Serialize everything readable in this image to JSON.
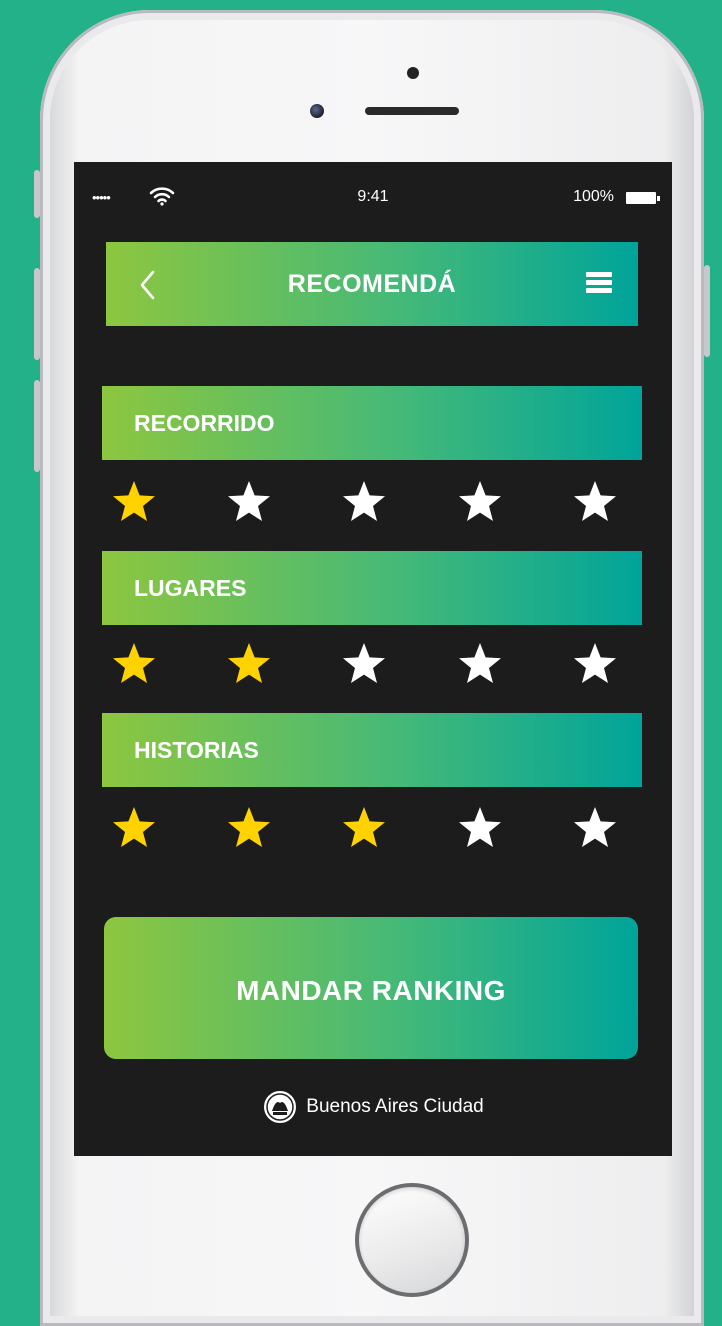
{
  "status_bar": {
    "signal": "•••••",
    "time": "9:41",
    "battery": "100%"
  },
  "header": {
    "title": "RECOMENDÁ",
    "back_icon": "chevron-left-icon",
    "menu_icon": "hamburger-menu-icon"
  },
  "categories": [
    {
      "label": "RECORRIDO",
      "rating": 1,
      "max": 5
    },
    {
      "label": "LUGARES",
      "rating": 2,
      "max": 5
    },
    {
      "label": "HISTORIAS",
      "rating": 3,
      "max": 5
    }
  ],
  "send_button": {
    "label": "MANDAR RANKING"
  },
  "footer": {
    "brand": "Buenos Aires Ciudad",
    "logo_icon": "city-seal-icon"
  },
  "colors": {
    "background": "#22b188",
    "screen": "#1c1c1c",
    "gradient_start": "#8dc63f",
    "gradient_end": "#00a49a",
    "star_filled": "#ffd200",
    "star_empty": "#ffffff"
  }
}
